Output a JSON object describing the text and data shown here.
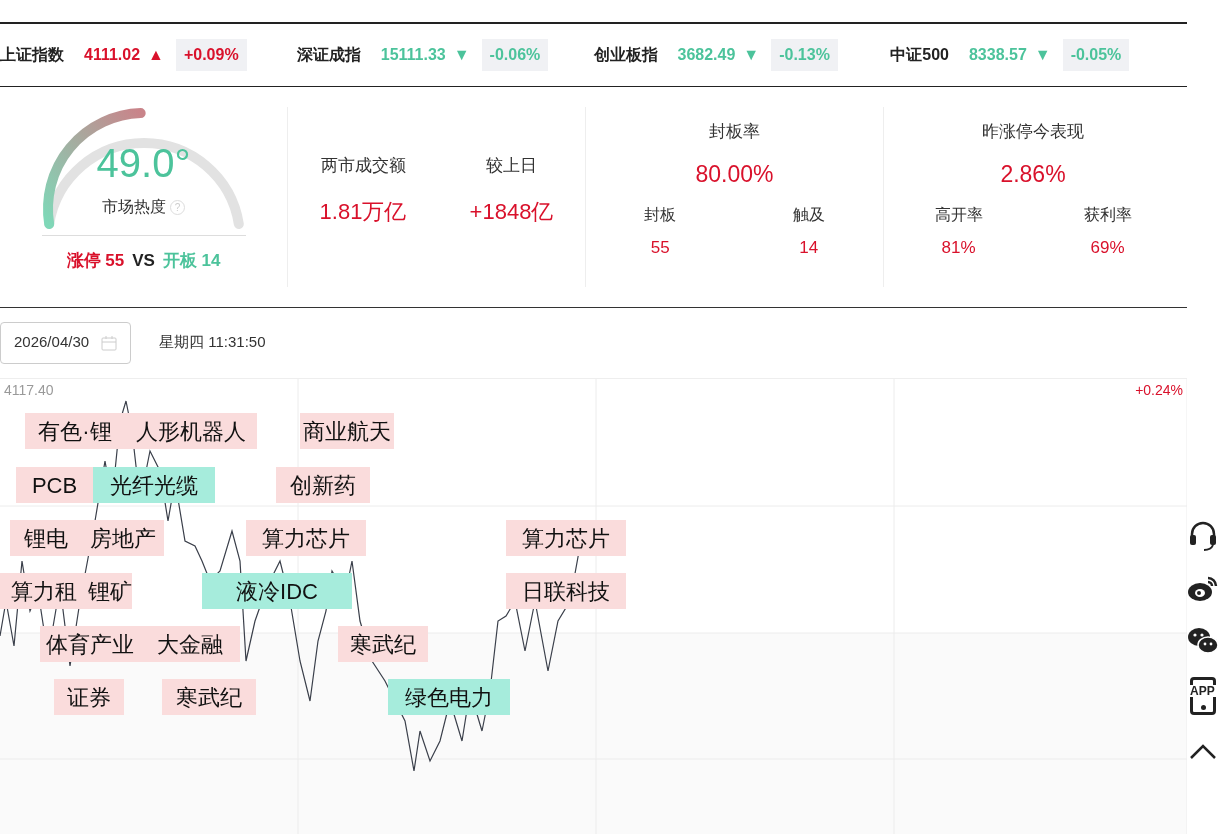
{
  "indices": [
    {
      "name": "上证指数",
      "value": "4111.02",
      "up": true,
      "arrow": "▲",
      "change": "+0.09%"
    },
    {
      "name": "深证成指",
      "value": "15111.33",
      "up": false,
      "arrow": "▼",
      "change": "-0.06%"
    },
    {
      "name": "创业板指",
      "value": "3682.49",
      "up": false,
      "arrow": "▼",
      "change": "-0.13%"
    },
    {
      "name": "中证500",
      "value": "8338.57",
      "up": false,
      "arrow": "▼",
      "change": "-0.05%"
    }
  ],
  "heat": {
    "value": "49.0°",
    "label": "市场热度",
    "level": 0.49,
    "help": "?",
    "limit_up_label": "涨停",
    "limit_up": "55",
    "vs": "VS",
    "opened_label": "开板",
    "opened": "14"
  },
  "turnover": {
    "items": [
      {
        "label": "两市成交额",
        "value": "1.81万亿"
      },
      {
        "label": "较上日",
        "value": "+1848亿"
      }
    ]
  },
  "seal_rate": {
    "title": "封板率",
    "value": "80.00%",
    "items": [
      {
        "label": "封板",
        "value": "55"
      },
      {
        "label": "触及",
        "value": "14"
      }
    ]
  },
  "yesterday": {
    "title": "昨涨停今表现",
    "value": "2.86%",
    "items": [
      {
        "label": "高开率",
        "value": "81%"
      },
      {
        "label": "获利率",
        "value": "69%"
      }
    ]
  },
  "date_field": {
    "value": "2026/04/30"
  },
  "time": "星期四 11:31:50",
  "chart": {
    "top_value": "4117.40",
    "top_change": "+0.24%",
    "labels": [
      {
        "text": "有色·锂",
        "color": "#fadcdc"
      },
      {
        "text": "人形机器人",
        "color": "#fadcdc"
      },
      {
        "text": "商业航天",
        "color": "#fadcdc"
      },
      {
        "text": "PCB",
        "color": "#fadcdc"
      },
      {
        "text": "光纤光缆",
        "color": "#a6ecdc"
      },
      {
        "text": "创新药",
        "color": "#fadcdc"
      },
      {
        "text": "锂电",
        "color": "#fadcdc"
      },
      {
        "text": "房地产",
        "color": "#fadcdc"
      },
      {
        "text": "算力芯片",
        "color": "#fadcdc"
      },
      {
        "text": "算力芯片",
        "color": "#fadcdc"
      },
      {
        "text": "算力租",
        "color": "#fadcdc"
      },
      {
        "text": "锂矿",
        "color": "#fadcdc"
      },
      {
        "text": "液冷IDC",
        "color": "#a6ecdc"
      },
      {
        "text": "日联科技",
        "color": "#fadcdc"
      },
      {
        "text": "体育产业",
        "color": "#fadcdc"
      },
      {
        "text": "大金融",
        "color": "#fadcdc"
      },
      {
        "text": "寒武纪",
        "color": "#fadcdc"
      },
      {
        "text": "证券",
        "color": "#fadcdc"
      },
      {
        "text": "寒武纪",
        "color": "#fadcdc"
      },
      {
        "text": "绿色电力",
        "color": "#a6ecdc"
      }
    ]
  },
  "side_tools": [
    {
      "kind": "headset"
    },
    {
      "kind": "weibo"
    },
    {
      "kind": "wechat"
    },
    {
      "kind": "app",
      "text": "APP"
    },
    {
      "kind": "top"
    }
  ]
}
